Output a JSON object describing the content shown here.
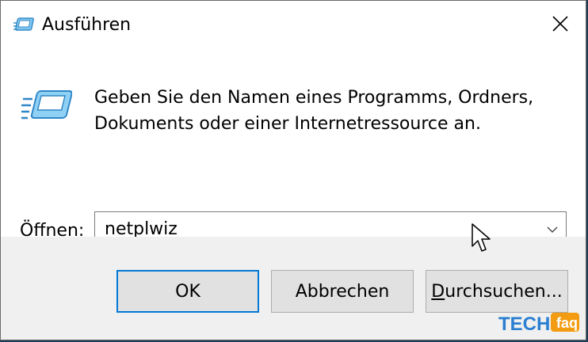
{
  "window": {
    "title": "Ausführen",
    "close_icon": "close-icon"
  },
  "content": {
    "message_line1": "Geben Sie den Namen eines Programms, Ordners,",
    "message_line2": "Dokuments oder einer Internetressource an.",
    "open_label_prefix": "",
    "open_label_mnemonic": "Ö",
    "open_label_rest": "ffnen:",
    "combo_value": "netplwiz"
  },
  "buttons": {
    "ok": "OK",
    "cancel": "Abbrechen",
    "browse_mnemonic": "D",
    "browse_rest": "urchsuchen..."
  },
  "watermark": {
    "text_main": "TECH",
    "text_badge": "faq"
  },
  "colors": {
    "accent": "#0078d7",
    "button_bg": "#e1e1e1",
    "footer_bg": "#f0f0f0"
  }
}
